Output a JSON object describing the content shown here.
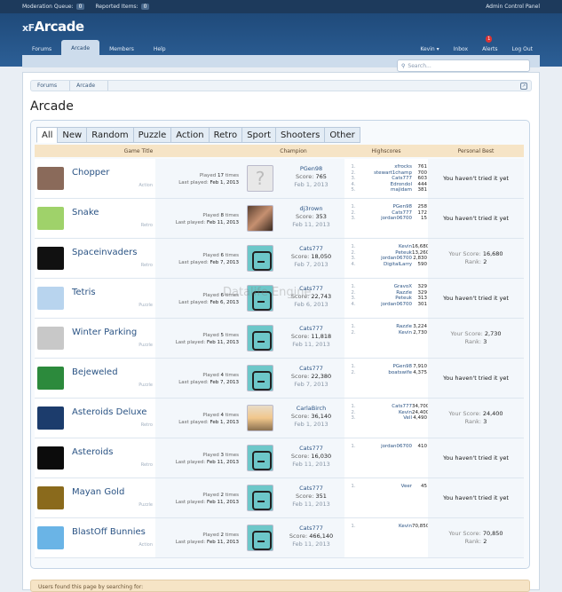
{
  "topbar": {
    "moderation_label": "Moderation Queue:",
    "moderation_count": "0",
    "reported_label": "Reported Items:",
    "reported_count": "0",
    "admin_label": "Admin Control Panel"
  },
  "header": {
    "logo_prefix": "xF",
    "logo_main": "Arcade"
  },
  "nav": {
    "tabs": [
      "Forums",
      "Arcade",
      "Members",
      "Help"
    ],
    "active": "Arcade",
    "right": {
      "user": "Kevin",
      "inbox": "Inbox",
      "alerts": "Alerts",
      "alerts_count": "1",
      "logout": "Log Out"
    }
  },
  "search": {
    "placeholder": "Search..."
  },
  "breadcrumb": [
    "Forums",
    "Arcade"
  ],
  "page_title": "Arcade",
  "filter_tabs": [
    "All",
    "New",
    "Random",
    "Puzzle",
    "Action",
    "Retro",
    "Sport",
    "Shooters",
    "Other"
  ],
  "columns": {
    "game_title": "Game Title",
    "champion": "Champion",
    "highscores": "Highscores",
    "personal_best": "Personal Best"
  },
  "watermark": "Datalife Engine",
  "footer_note": "Users found this page by searching for:",
  "games": [
    {
      "name": "Chopper",
      "category": "Action",
      "thumb": "#8a6a5a",
      "played": "17",
      "last": "Feb 1, 2013",
      "avatar": "q",
      "champ": "PGen98",
      "score": "765",
      "date": "Feb 1, 2013",
      "hs": [
        [
          "1.",
          "xfrocks",
          "761"
        ],
        [
          "2.",
          "stewart1champ",
          "700"
        ],
        [
          "3.",
          "Cats777",
          "603"
        ],
        [
          "4.",
          "Edrondol",
          "444"
        ],
        [
          "5.",
          "majidam",
          "381"
        ]
      ],
      "best": "You haven't tried it yet",
      "rank": ""
    },
    {
      "name": "Snake",
      "category": "Retro",
      "thumb": "#9fd26a",
      "played": "8",
      "last": "Feb 11, 2013",
      "avatar": "photo1",
      "champ": "dj3rown",
      "score": "353",
      "date": "Feb 11, 2013",
      "hs": [
        [
          "1.",
          "PGen98",
          "258"
        ],
        [
          "2.",
          "Cats777",
          "172"
        ],
        [
          "3.",
          "jordan06700",
          "15"
        ]
      ],
      "best": "You haven't tried it yet",
      "rank": ""
    },
    {
      "name": "Spaceinvaders",
      "category": "Retro",
      "thumb": "#111111",
      "played": "6",
      "last": "Feb 7, 2013",
      "avatar": "smiley",
      "champ": "Cats777",
      "score": "18,050",
      "date": "Feb 7, 2013",
      "hs": [
        [
          "1.",
          "Kevin",
          "16,680"
        ],
        [
          "2.",
          "Peteuk",
          "13,260"
        ],
        [
          "3.",
          "jordan06700",
          "2,830"
        ],
        [
          "4.",
          "DigitalLarry",
          "590"
        ]
      ],
      "best": "16,680",
      "rank": "2"
    },
    {
      "name": "Tetris",
      "category": "Puzzle",
      "thumb": "#b8d4ee",
      "played": "6",
      "last": "Feb 6, 2013",
      "avatar": "smiley",
      "champ": "Cats777",
      "score": "22,743",
      "date": "Feb 6, 2013",
      "hs": [
        [
          "1.",
          "GravoX",
          "329"
        ],
        [
          "2.",
          "Razzle",
          "329"
        ],
        [
          "3.",
          "Peteuk",
          "313"
        ],
        [
          "4.",
          "jordan06700",
          "301"
        ]
      ],
      "best": "You haven't tried it yet",
      "rank": ""
    },
    {
      "name": "Winter Parking",
      "category": "Puzzle",
      "thumb": "#c8c8c8",
      "played": "5",
      "last": "Feb 11, 2013",
      "avatar": "smiley",
      "champ": "Cats777",
      "score": "11,818",
      "date": "Feb 11, 2013",
      "hs": [
        [
          "1.",
          "Razzle",
          "3,224"
        ],
        [
          "2.",
          "Kevin",
          "2,730"
        ]
      ],
      "best": "2,730",
      "rank": "3"
    },
    {
      "name": "Bejeweled",
      "category": "Puzzle",
      "thumb": "#2c8a3c",
      "played": "4",
      "last": "Feb 7, 2013",
      "avatar": "smiley",
      "champ": "Cats777",
      "score": "22,380",
      "date": "Feb 7, 2013",
      "hs": [
        [
          "1.",
          "PGen98",
          "7,910"
        ],
        [
          "2.",
          "boatswife",
          "4,375"
        ]
      ],
      "best": "You haven't tried it yet",
      "rank": ""
    },
    {
      "name": "Asteroids Deluxe",
      "category": "Retro",
      "thumb": "#1c3c6c",
      "played": "4",
      "last": "Feb 1, 2013",
      "avatar": "photo2",
      "champ": "CarlaBirch",
      "score": "36,140",
      "date": "Feb 1, 2013",
      "hs": [
        [
          "1.",
          "Cats777",
          "34,700"
        ],
        [
          "2.",
          "Kevin",
          "24,400"
        ],
        [
          "3.",
          "Vell",
          "4,490"
        ]
      ],
      "best": "24,400",
      "rank": "3"
    },
    {
      "name": "Asteroids",
      "category": "Retro",
      "thumb": "#0c0c0c",
      "played": "3",
      "last": "Feb 11, 2013",
      "avatar": "smiley",
      "champ": "Cats777",
      "score": "16,030",
      "date": "Feb 11, 2013",
      "hs": [
        [
          "1.",
          "jordan06700",
          "410"
        ]
      ],
      "best": "You haven't tried it yet",
      "rank": ""
    },
    {
      "name": "Mayan Gold",
      "category": "Puzzle",
      "thumb": "#8a6a1c",
      "played": "2",
      "last": "Feb 11, 2013",
      "avatar": "smiley",
      "champ": "Cats777",
      "score": "351",
      "date": "Feb 11, 2013",
      "hs": [
        [
          "1.",
          "Veer",
          "45"
        ]
      ],
      "best": "You haven't tried it yet",
      "rank": ""
    },
    {
      "name": "BlastOff Bunnies",
      "category": "Action",
      "thumb": "#6ab4e6",
      "played": "2",
      "last": "Feb 11, 2013",
      "avatar": "smiley",
      "champ": "Cats777",
      "score": "466,140",
      "date": "Feb 11, 2013",
      "hs": [
        [
          "1.",
          "Kevin",
          "70,850"
        ]
      ],
      "best": "70,850",
      "rank": "2"
    }
  ],
  "labels": {
    "played_prefix": "Played",
    "played_suffix": "times",
    "last_played": "Last played:",
    "score": "Score:",
    "your_score": "Your Score:",
    "rank": "Rank:"
  }
}
